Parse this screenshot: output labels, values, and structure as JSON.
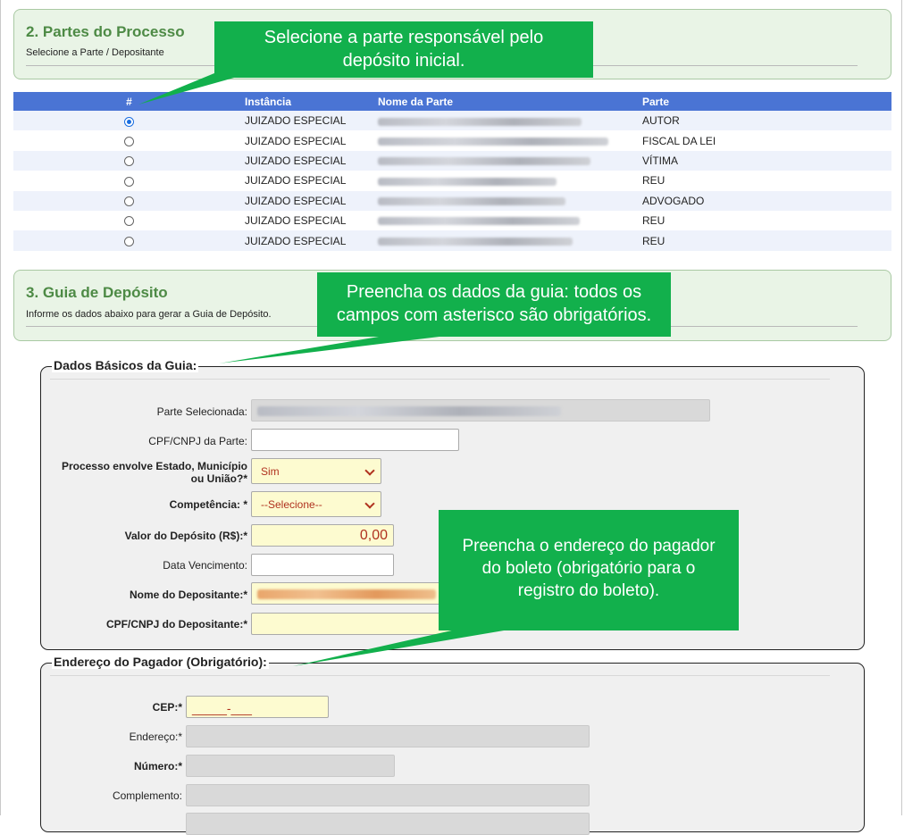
{
  "section2": {
    "title": "2. Partes do Processo",
    "subtitle": "Selecione a Parte / Depositante"
  },
  "table": {
    "headers": [
      "#",
      "Instância",
      "Nome da Parte",
      "Parte"
    ],
    "rows": [
      {
        "selected": true,
        "instancia": "JUIZADO ESPECIAL",
        "parte": "AUTOR"
      },
      {
        "selected": false,
        "instancia": "JUIZADO ESPECIAL",
        "parte": "FISCAL DA LEI"
      },
      {
        "selected": false,
        "instancia": "JUIZADO ESPECIAL",
        "parte": "VÍTIMA"
      },
      {
        "selected": false,
        "instancia": "JUIZADO ESPECIAL",
        "parte": "REU"
      },
      {
        "selected": false,
        "instancia": "JUIZADO ESPECIAL",
        "parte": "ADVOGADO"
      },
      {
        "selected": false,
        "instancia": "JUIZADO ESPECIAL",
        "parte": "REU"
      },
      {
        "selected": false,
        "instancia": "JUIZADO ESPECIAL",
        "parte": "REU"
      }
    ]
  },
  "section3": {
    "title": "3. Guia de Depósito",
    "subtitle": "Informe os dados abaixo para gerar a Guia de Depósito."
  },
  "dados_basicos": {
    "legend": "Dados Básicos da Guia:",
    "parte_selecionada_label": "Parte Selecionada:",
    "cpf_parte_label": "CPF/CNPJ da Parte:",
    "envolve_label_1": "Processo envolve Estado, Município",
    "envolve_label_2": "ou União?*",
    "envolve_value": "Sim",
    "competencia_label": "Competência: *",
    "competencia_value": "--Selecione--",
    "valor_label": "Valor do Depósito (R$):*",
    "valor_value": "0,00",
    "vencimento_label": "Data Vencimento:",
    "nome_depositante_label": "Nome do Depositante:*",
    "cpf_depositante_label": "CPF/CNPJ do Depositante:*"
  },
  "endereco": {
    "legend": "Endereço do Pagador (Obrigatório):",
    "cep_label": "CEP:*",
    "cep_value": "_____-___",
    "endereco_label": "Endereço:*",
    "numero_label": "Número:*",
    "complemento_label": "Complemento:"
  },
  "callouts": {
    "c1": [
      "Selecione a parte responsável pelo",
      "depósito inicial."
    ],
    "c2": [
      "Preencha os dados da guia: todos os",
      "campos com asterisco são obrigatórios."
    ],
    "c3": [
      "Preencha o endereço do pagador",
      "do boleto (obrigatório para o",
      "registro do boleto)."
    ]
  },
  "colors": {
    "section_bg": "#e9f4e6",
    "section_title": "#4d8a45",
    "table_header": "#4a74d4",
    "callout": "#12b04c",
    "required_field": "#fdfbd0",
    "readonly_field": "#d9d9d9"
  }
}
